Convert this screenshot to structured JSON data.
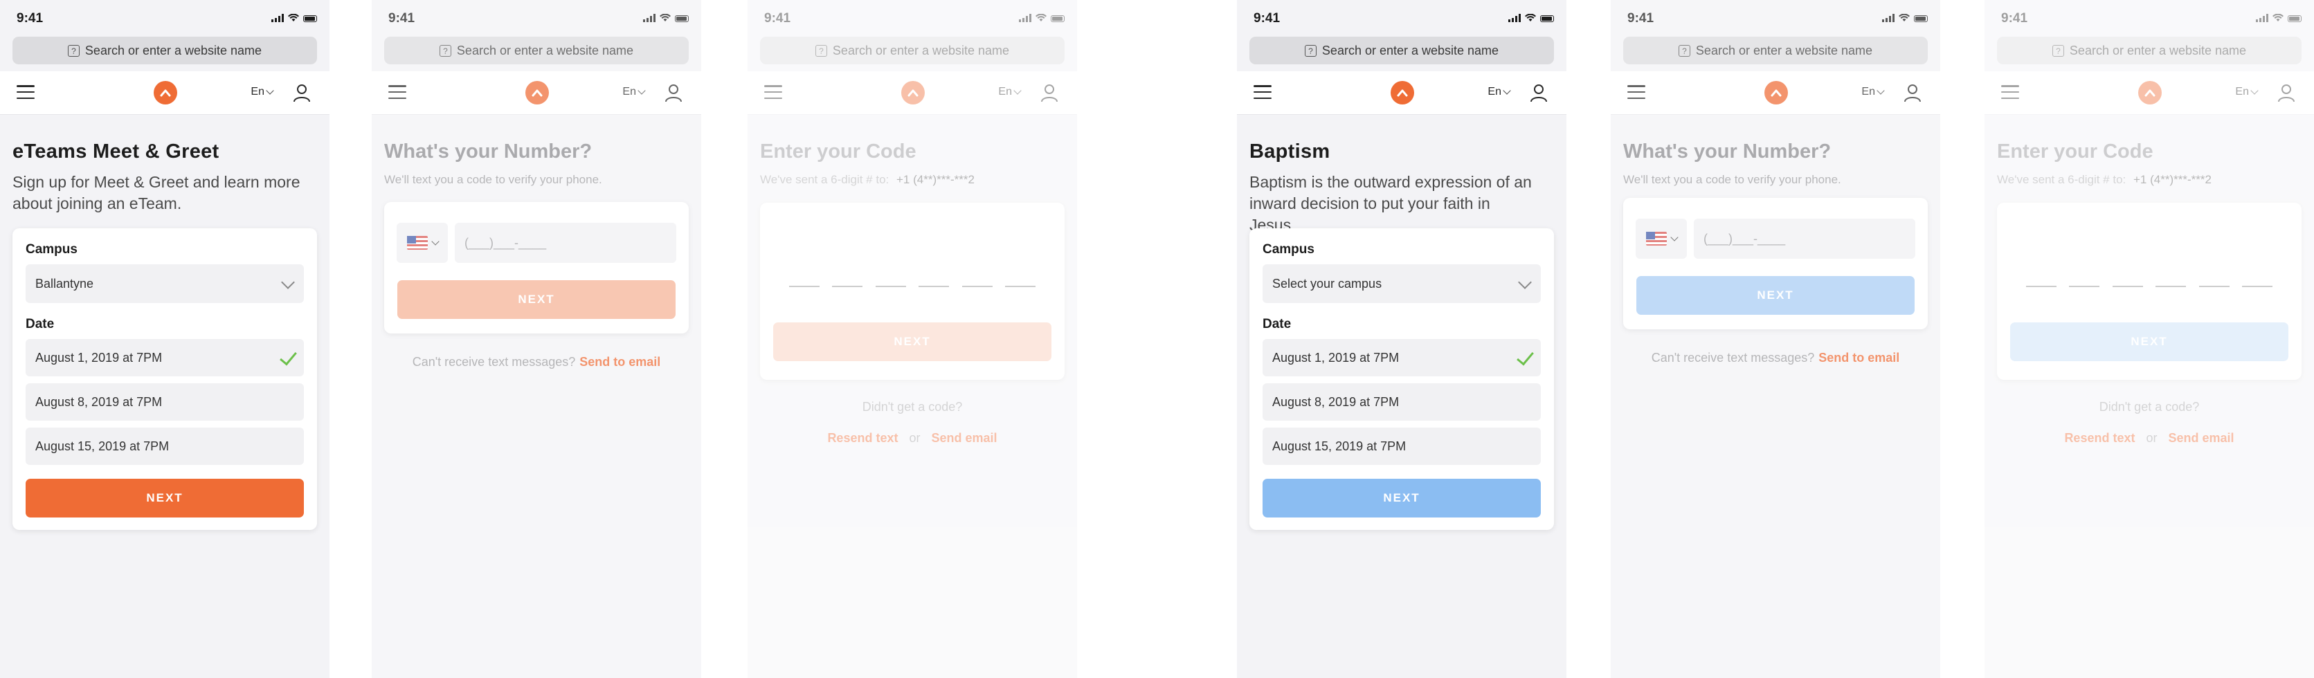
{
  "common": {
    "time": "9:41",
    "url_placeholder": "Search or enter a website name",
    "language": "En",
    "next_label": "NEXT",
    "icons": [
      "signal-icon",
      "wifi-icon",
      "battery-icon",
      "hamburger-icon",
      "church-logo-icon",
      "user-icon",
      "chevron-down-icon",
      "check-icon",
      "us-flag-icon"
    ]
  },
  "screens": [
    {
      "title": "eTeams Meet & Greet",
      "subtitle": "Sign up for Meet & Greet and learn more about joining an eTeam.",
      "campus_label": "Campus",
      "campus_value": "Ballantyne",
      "date_label": "Date",
      "dates": [
        "August 1, 2019 at 7PM",
        "August 8, 2019 at 7PM",
        "August 15, 2019 at 7PM"
      ],
      "selected_date_index": 0,
      "button_color": "#ef6c35"
    },
    {
      "title": "What's your Number?",
      "subtitle": "We'll text you a code to verify your phone.",
      "phone_placeholder": "(___)___-____",
      "helper_text": "Can't receive text messages?",
      "helper_link": "Send to email",
      "button_color": "#f6b295"
    },
    {
      "title": "Enter your Code",
      "subtitle_prefix": "We've sent a 6-digit # to:",
      "masked_number": "+1 (4**)***-***2",
      "code_length": 6,
      "didnt_get": "Didn't get a code?",
      "resend": "Resend text",
      "or": "or",
      "send_email": "Send email",
      "button_color": "#f9c8b3"
    },
    {
      "title": "Baptism",
      "subtitle": "Baptism is the outward expression of an inward decision to put your faith in Jesus.",
      "campus_label": "Campus",
      "campus_value": "Select your campus",
      "date_label": "Date",
      "dates": [
        "August 1, 2019 at 7PM",
        "August 8, 2019 at 7PM",
        "August 15, 2019 at 7PM"
      ],
      "selected_date_index": 0,
      "button_color": "#8bbdf2"
    },
    {
      "title": "What's your Number?",
      "subtitle": "We'll text you a code to verify your phone.",
      "phone_placeholder": "(___)___-____",
      "helper_text": "Can't receive text messages?",
      "helper_link": "Send to email",
      "button_color": "#a8cdf4"
    },
    {
      "title": "Enter your Code",
      "subtitle_prefix": "We've sent a 6-digit # to:",
      "masked_number": "+1 (4**)***-***2",
      "code_length": 6,
      "didnt_get": "Didn't get a code?",
      "resend": "Resend text",
      "or": "or",
      "send_email": "Send email",
      "button_color": "#c3dcf7"
    }
  ]
}
